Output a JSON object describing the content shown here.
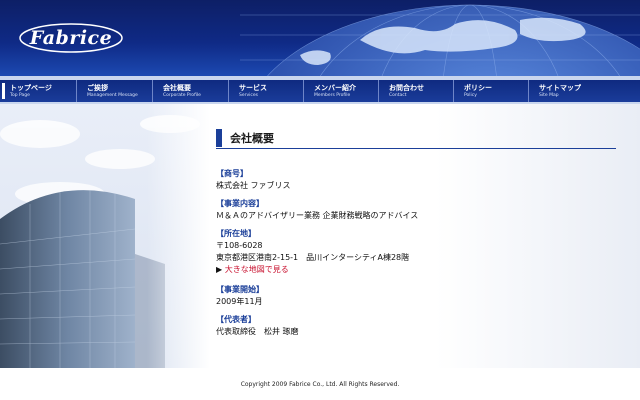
{
  "header": {
    "logo_text": "Fabrice"
  },
  "nav": {
    "items": [
      {
        "label": "トップページ",
        "sub": "Top Page"
      },
      {
        "label": "ご挨拶",
        "sub": "Management Message"
      },
      {
        "label": "会社概要",
        "sub": "Corporate Profile"
      },
      {
        "label": "サービス",
        "sub": "Services"
      },
      {
        "label": "メンバー紹介",
        "sub": "Members Profile"
      },
      {
        "label": "お問合わせ",
        "sub": "Contact"
      },
      {
        "label": "ポリシー",
        "sub": "Policy"
      },
      {
        "label": "サイトマップ",
        "sub": "Site Map"
      }
    ]
  },
  "main": {
    "title": "会社概要",
    "sections": [
      {
        "heading": "【商号】",
        "lines": [
          "株式会社 ファブリス"
        ]
      },
      {
        "heading": "【事業内容】",
        "lines": [
          "Ｍ＆Ａのアドバイザリー業務 企業財務戦略のアドバイス"
        ]
      },
      {
        "heading": "【所在地】",
        "lines": [
          "〒108-6028",
          "東京都港区港南2-15-1　品川インターシティA棟28階"
        ],
        "link_prefix": "▶ ",
        "link": "大きな地図で見る"
      },
      {
        "heading": "【事業開始】",
        "lines": [
          "2009年11月"
        ]
      },
      {
        "heading": "【代表者】",
        "lines": [
          "代表取締役　松井 琢磨"
        ]
      }
    ]
  },
  "footer": {
    "copyright": "Copyright 2009 Fabrice Co., Ltd. All Rights Reserved."
  },
  "colors": {
    "header_dark": "#0d1f66",
    "accent_blue": "#1b3f99",
    "link_red": "#c8102e"
  }
}
